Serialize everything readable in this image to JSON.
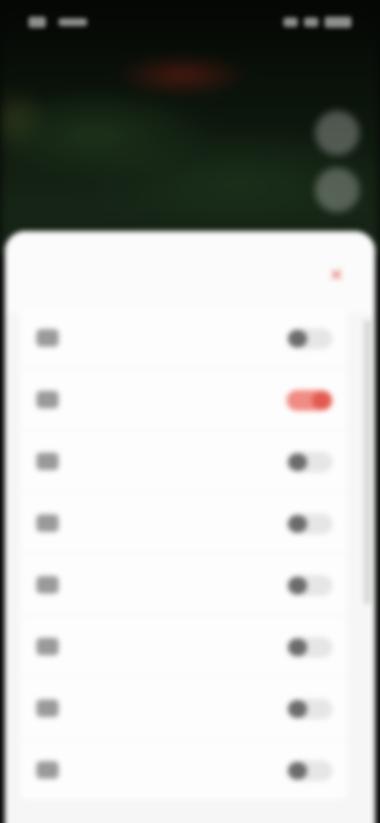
{
  "status_bar": {
    "time": "",
    "icons": [
      "signal-icon",
      "wifi-icon",
      "battery-icon"
    ]
  },
  "video": {
    "title": ""
  },
  "sheet": {
    "title": "",
    "close_icon": "close-icon",
    "accent_color": "#e25a4f",
    "items": [
      {
        "label": "",
        "icon": "settings-item-icon",
        "enabled": false
      },
      {
        "label": "",
        "icon": "settings-item-icon",
        "enabled": true
      },
      {
        "label": "",
        "icon": "settings-item-icon",
        "enabled": false
      },
      {
        "label": "",
        "icon": "settings-item-icon",
        "enabled": false
      },
      {
        "label": "",
        "icon": "settings-item-icon",
        "enabled": false
      },
      {
        "label": "",
        "icon": "settings-item-icon",
        "enabled": false
      },
      {
        "label": "",
        "icon": "settings-item-icon",
        "enabled": false
      },
      {
        "label": "",
        "icon": "settings-item-icon",
        "enabled": false
      }
    ]
  }
}
